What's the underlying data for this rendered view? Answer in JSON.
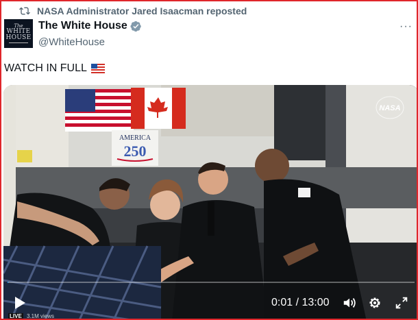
{
  "repost": {
    "text": "NASA Administrator Jared Isaacman reposted",
    "icon": "repost-icon"
  },
  "author": {
    "name": "The White House",
    "handle": "@WhiteHouse",
    "verified": true,
    "verified_color": "#829aab",
    "avatar_lines": [
      "The",
      "WHITE",
      "HOUSE"
    ]
  },
  "more_label": "···",
  "tweet": {
    "text": "WATCH IN FULL",
    "emoji": "us-flag-emoji"
  },
  "video": {
    "banner": {
      "line1": "AMERICA",
      "line2": "250"
    },
    "logo": "NASA",
    "time_current": "0:01",
    "time_total": "13:00",
    "time_display": "0:01 / 13:00",
    "live_label": "LIVE",
    "views": "3.1M views",
    "progress": 0.001,
    "progress_color": "#1d9bf0",
    "controls": [
      "play-icon",
      "volume-icon",
      "settings-icon",
      "fullscreen-icon"
    ]
  },
  "colors": {
    "frame_border": "#e0262b",
    "secondary_text": "#536471",
    "primary_text": "#0f1419"
  }
}
